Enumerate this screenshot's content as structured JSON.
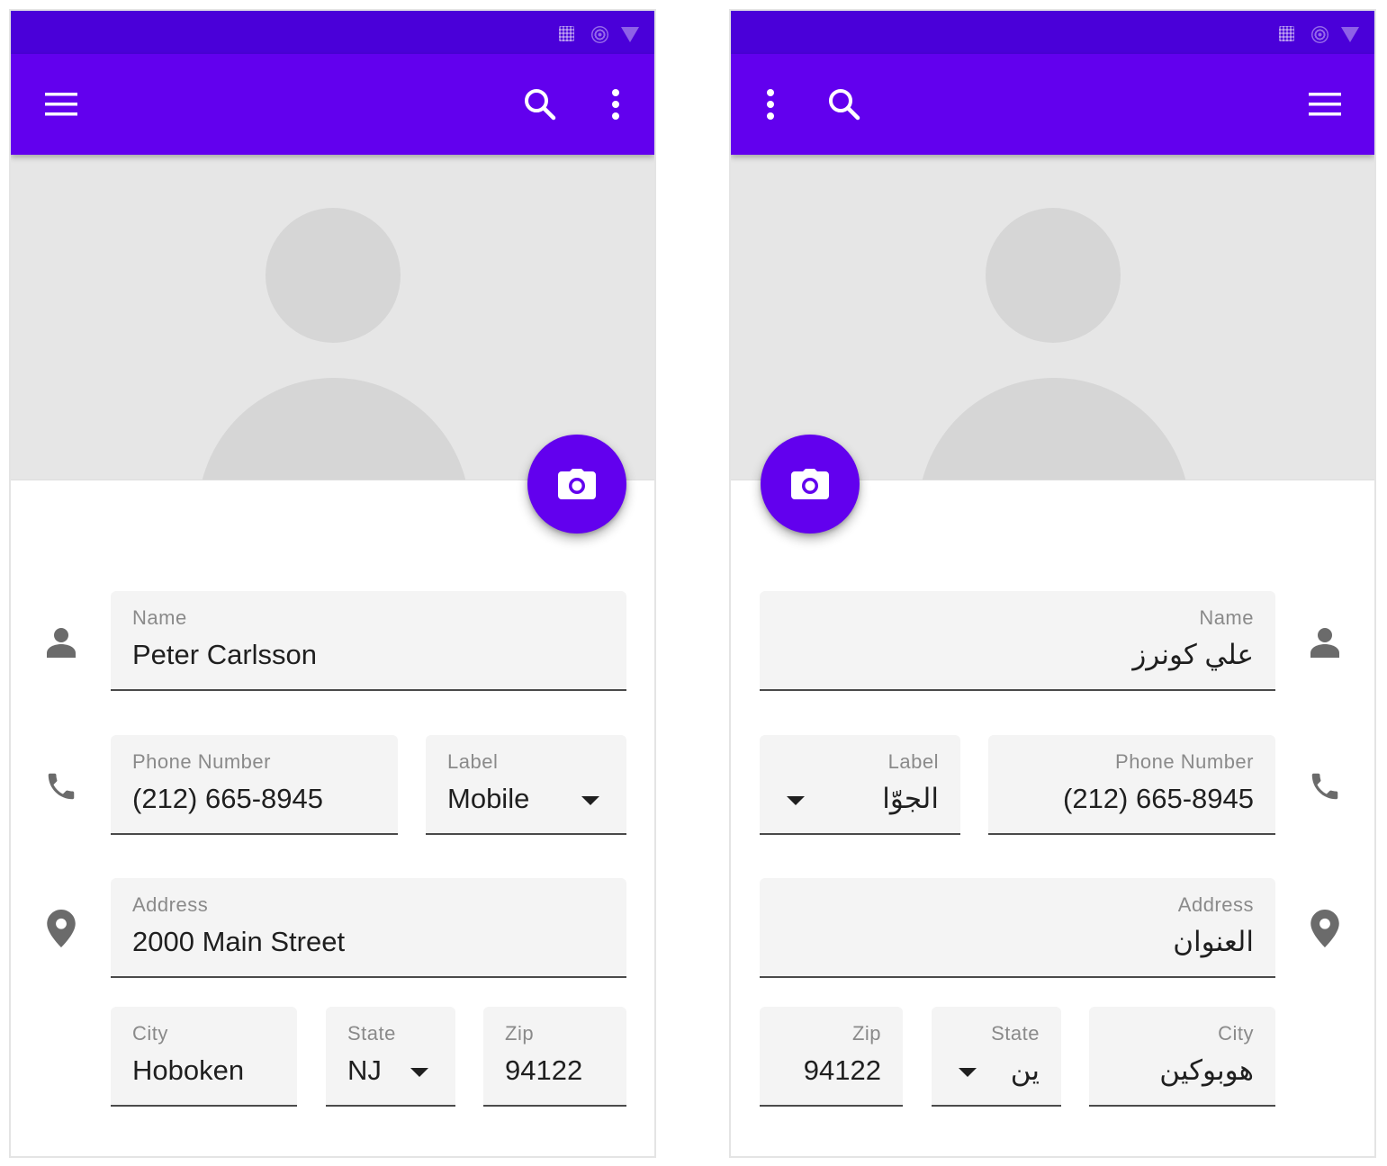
{
  "colors": {
    "status_bar": "#4a00d9",
    "app_bar": "#6200ee",
    "accent": "#6200ee",
    "hero_bg": "#e6e6e6",
    "field_bg": "#f4f4f4"
  },
  "icons": {
    "status": [
      "signal-icon",
      "wifi-icon",
      "battery-icon"
    ],
    "app_bar": [
      "menu-icon",
      "search-icon",
      "more-vert-icon"
    ],
    "fab": "camera-icon",
    "rows": [
      "person-icon",
      "phone-icon",
      "location-pin-icon"
    ],
    "dropdown": "arrow-drop-down-icon"
  },
  "ltr": {
    "name": {
      "label": "Name",
      "value": "Peter Carlsson"
    },
    "phone": {
      "label": "Phone Number",
      "value": "(212) 665-8945"
    },
    "phone_type": {
      "label": "Label",
      "value": "Mobile"
    },
    "address": {
      "label": "Address",
      "value": "2000 Main Street"
    },
    "city": {
      "label": "City",
      "value": "Hoboken"
    },
    "state": {
      "label": "State",
      "value": "NJ"
    },
    "zip": {
      "label": "Zip",
      "value": "94122"
    }
  },
  "rtl": {
    "name": {
      "label": "Name",
      "value": "علي كونرز"
    },
    "phone": {
      "label": "Phone Number",
      "value": "(212) 665-8945"
    },
    "phone_type": {
      "label": "Label",
      "value": "الجوّا"
    },
    "address": {
      "label": "Address",
      "value": "العنوان"
    },
    "city": {
      "label": "City",
      "value": "هوبوكين"
    },
    "state": {
      "label": "State",
      "value": "ين"
    },
    "zip": {
      "label": "Zip",
      "value": "94122"
    }
  }
}
